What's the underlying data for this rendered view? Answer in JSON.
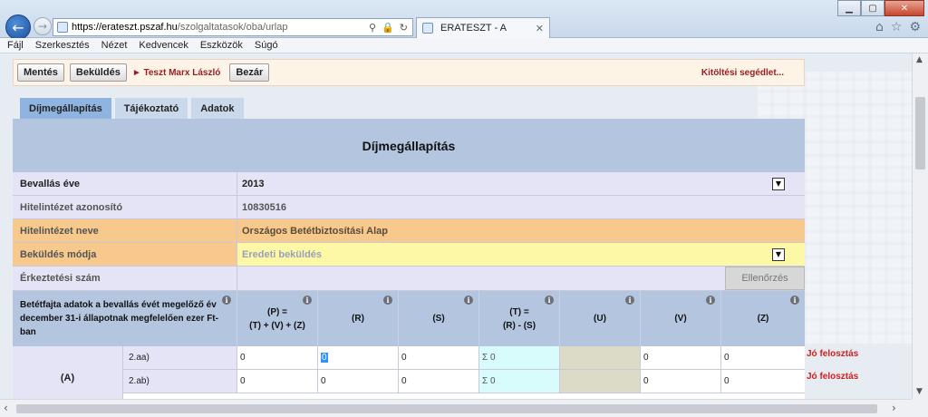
{
  "browser": {
    "url_host": "https://erateszt.pszaf.hu",
    "url_path": "/szolgaltatasok/oba/urlap",
    "tab_title": "ERATESZT - A",
    "addr_search_icon": "⚲",
    "addr_lock_icon": "🔒",
    "addr_refresh_icon": "↻"
  },
  "menu": [
    "Fájl",
    "Szerkesztés",
    "Nézet",
    "Kedvencek",
    "Eszközök",
    "Súgó"
  ],
  "toolbar": {
    "save_label": "Mentés",
    "submit_label": "Beküldés",
    "user_label": "► Teszt Marx László",
    "close_label": "Bezár",
    "helper_label": "Kitöltési segédlet..."
  },
  "tabs": [
    "Díjmegállapítás",
    "Tájékoztató",
    "Adatok"
  ],
  "form": {
    "title": "Díjmegállapítás",
    "fields": {
      "year_label": "Bevallás éve",
      "year_value": "2013",
      "id_label": "Hitelintézet azonosító",
      "id_value": "10830516",
      "name_label": "Hitelintézet neve",
      "name_value": "Országos Betétbiztosítási Alap",
      "mode_label": "Beküldés módja",
      "mode_value": "Eredeti beküldés",
      "regno_label": "Érkeztetési szám",
      "check_label": "Ellenőrzés"
    },
    "grid": {
      "first_header": "Betétfajta adatok a bevallás évét megelőző év december 31-i állapotnak megfelelően ezer Ft-ban",
      "col_headers": [
        "(P) =\n(T) + (V) + (Z)",
        "(R)",
        "(S)",
        "(T) =\n(R) - (S)",
        "(U)",
        "(V)",
        "(Z)"
      ],
      "section_label": "(A)",
      "rows": [
        {
          "sub": "2.aa)",
          "cells": [
            "0",
            "0",
            "0",
            "Σ 0",
            "",
            "0",
            "0"
          ],
          "status": "Jó felosztás"
        },
        {
          "sub": "2.ab)",
          "cells": [
            "0",
            "0",
            "0",
            "Σ 0",
            "",
            "0",
            "0"
          ],
          "status": "Jó felosztás"
        }
      ]
    }
  }
}
